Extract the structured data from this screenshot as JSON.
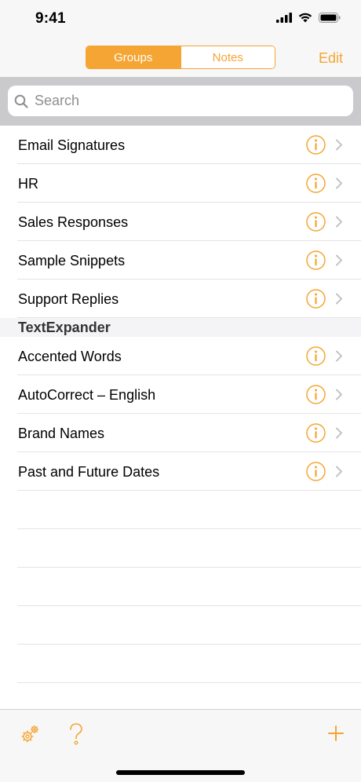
{
  "status_bar": {
    "time": "9:41"
  },
  "nav": {
    "segments": [
      "Groups",
      "Notes"
    ],
    "selected_segment": "Groups",
    "edit_label": "Edit"
  },
  "search": {
    "placeholder": "Search"
  },
  "groups": [
    {
      "label": "Email Signatures"
    },
    {
      "label": "HR"
    },
    {
      "label": "Sales Responses"
    },
    {
      "label": "Sample Snippets"
    },
    {
      "label": "Support Replies"
    }
  ],
  "section": {
    "title": "TextExpander",
    "items": [
      {
        "label": "Accented Words"
      },
      {
        "label": "AutoCorrect – English"
      },
      {
        "label": "Brand Names"
      },
      {
        "label": "Past and Future Dates"
      }
    ]
  },
  "toolbar": {
    "buttons": [
      "gear-icon",
      "help-icon",
      "add-icon"
    ]
  },
  "colors": {
    "accent": "#f5a533",
    "separator": "#e4e4e4",
    "search_background": "#cacacd",
    "bar_background": "#f7f7f7"
  }
}
